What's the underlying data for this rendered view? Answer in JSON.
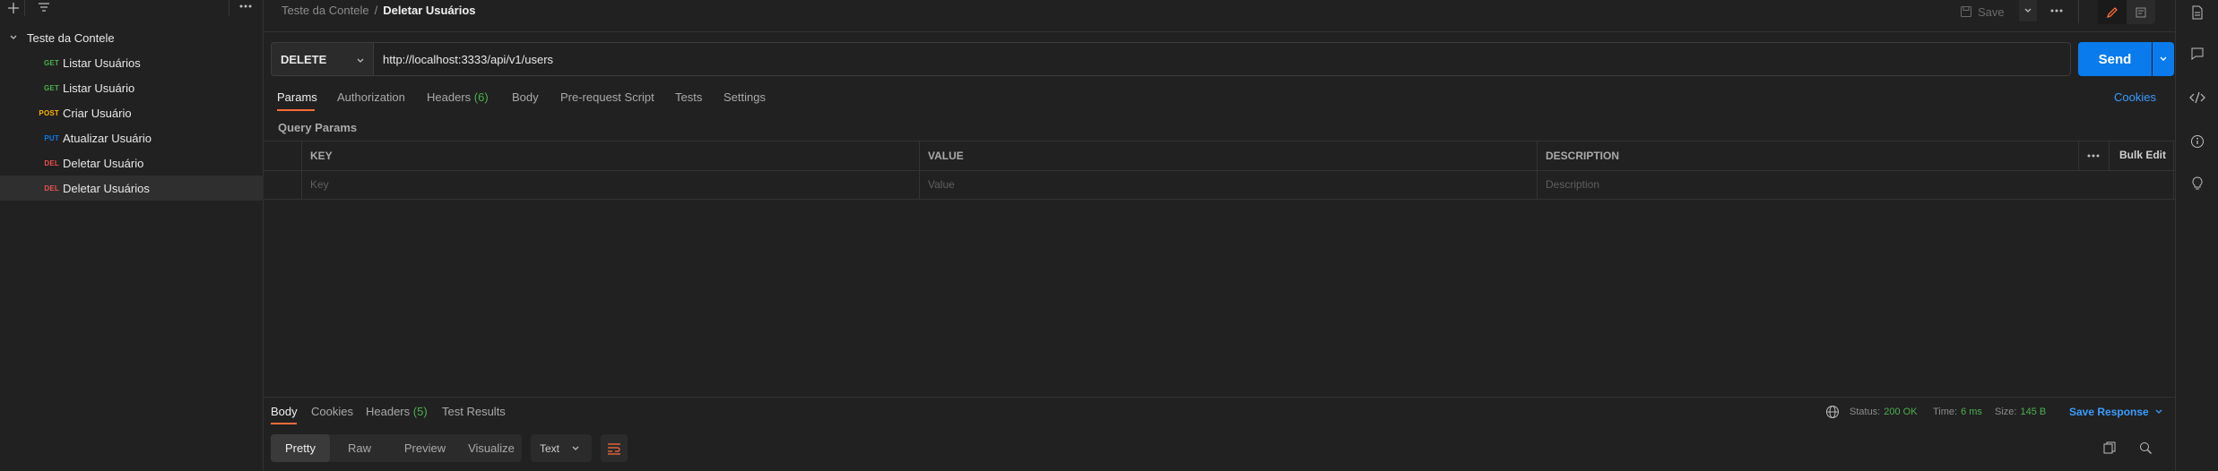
{
  "sidebar": {
    "collection": {
      "name": "Teste da Contele"
    },
    "requests": [
      {
        "method": "GET",
        "method_color": "#4caf50",
        "name": "Listar Usuários"
      },
      {
        "method": "GET",
        "method_color": "#4caf50",
        "name": "Listar Usuário"
      },
      {
        "method": "POST",
        "method_color": "#ffb400",
        "name": "Criar Usuário"
      },
      {
        "method": "PUT",
        "method_color": "#097bed",
        "name": "Atualizar Usuário"
      },
      {
        "method": "DEL",
        "method_color": "#f05050",
        "name": "Deletar Usuário"
      },
      {
        "method": "DEL",
        "method_color": "#f05050",
        "name": "Deletar Usuários"
      }
    ]
  },
  "header": {
    "breadcrumb_parent": "Teste da Contele",
    "breadcrumb_sep": "/",
    "breadcrumb_current": "Deletar Usuários",
    "save_label": "Save"
  },
  "request": {
    "method": "DELETE",
    "url": "http://localhost:3333/api/v1/users",
    "send_label": "Send"
  },
  "tabs": [
    {
      "label": "Params",
      "count": ""
    },
    {
      "label": "Authorization",
      "count": ""
    },
    {
      "label": "Headers",
      "count": "(6)"
    },
    {
      "label": "Body",
      "count": ""
    },
    {
      "label": "Pre-request Script",
      "count": ""
    },
    {
      "label": "Tests",
      "count": ""
    },
    {
      "label": "Settings",
      "count": ""
    }
  ],
  "cookies_link": "Cookies",
  "params": {
    "section_title": "Query Params",
    "columns": {
      "key": "KEY",
      "value": "VALUE",
      "description": "DESCRIPTION"
    },
    "bulk_edit": "Bulk Edit",
    "placeholders": {
      "key": "Key",
      "value": "Value",
      "description": "Description"
    }
  },
  "response": {
    "tabs": [
      {
        "label": "Body",
        "count": ""
      },
      {
        "label": "Cookies",
        "count": ""
      },
      {
        "label": "Headers",
        "count": "(5)"
      },
      {
        "label": "Test Results",
        "count": ""
      }
    ],
    "status_label": "Status:",
    "status_value": "200 OK",
    "time_label": "Time:",
    "time_value": "6 ms",
    "size_label": "Size:",
    "size_value": "145 B",
    "save_response": "Save Response",
    "view_modes": [
      "Pretty",
      "Raw",
      "Preview",
      "Visualize"
    ],
    "format": "Text"
  },
  "colors": {
    "accent_orange": "#ff6c37",
    "send_blue": "#097bed",
    "status_green": "#4caf50",
    "link_blue": "#3b9cff"
  },
  "icons": {
    "rail": [
      "document-icon",
      "comment-icon",
      "code-icon",
      "info-icon",
      "lightbulb-icon"
    ]
  }
}
